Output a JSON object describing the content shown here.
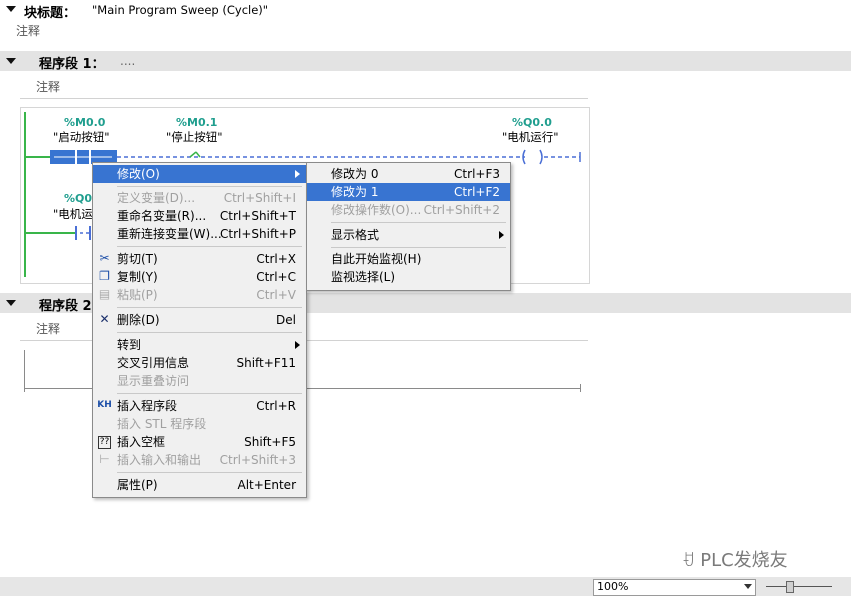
{
  "block": {
    "title_label": "块标题：",
    "title_value": "\"Main Program Sweep (Cycle)\"",
    "comment": "注释"
  },
  "network1": {
    "label": "程序段 1：",
    "title_placeholder": "....",
    "comment": "注释",
    "contact1": {
      "address": "%M0.0",
      "symbol": "\"启动按钮\""
    },
    "contact2": {
      "address": "%M0.1",
      "symbol": "\"停止按钮\""
    },
    "coil": {
      "address": "%Q0.0",
      "symbol": "\"电机运行\""
    },
    "contact3": {
      "address": "%Q0.",
      "symbol": "\"电机运"
    }
  },
  "network2": {
    "label": "程序段 2",
    "comment": "注释"
  },
  "context_menu": {
    "items": [
      {
        "label": "修改(O)",
        "shortcut": "",
        "submenu": true,
        "highlighted": true,
        "disabled": false
      },
      {
        "label": "定义变量(D)...",
        "shortcut": "Ctrl+Shift+I",
        "disabled": true
      },
      {
        "label": "重命名变量(R)...",
        "shortcut": "Ctrl+Shift+T"
      },
      {
        "label": "重新连接变量(W)...",
        "shortcut": "Ctrl+Shift+P"
      },
      {
        "label": "剪切(T)",
        "shortcut": "Ctrl+X",
        "icon": "scissors-icon"
      },
      {
        "label": "复制(Y)",
        "shortcut": "Ctrl+C",
        "icon": "copy-icon"
      },
      {
        "label": "粘贴(P)",
        "shortcut": "Ctrl+V",
        "icon": "paste-icon",
        "disabled": true
      },
      {
        "label": "删除(D)",
        "shortcut": "Del",
        "icon": "delete-icon"
      },
      {
        "label": "转到",
        "shortcut": "",
        "submenu": true
      },
      {
        "label": "交叉引用信息",
        "shortcut": "Shift+F11"
      },
      {
        "label": "显示重叠访问",
        "shortcut": "",
        "disabled": true
      },
      {
        "label": "插入程序段",
        "shortcut": "Ctrl+R",
        "icon": "insert-network-icon"
      },
      {
        "label": "插入 STL 程序段",
        "shortcut": "",
        "disabled": true
      },
      {
        "label": "插入空框",
        "shortcut": "Shift+F5",
        "icon": "empty-box-icon"
      },
      {
        "label": "插入输入和输出",
        "shortcut": "Ctrl+Shift+3",
        "icon": "insert-io-icon",
        "disabled": true
      },
      {
        "label": "属性(P)",
        "shortcut": "Alt+Enter"
      }
    ]
  },
  "submenu": {
    "items": [
      {
        "label": "修改为 0",
        "shortcut": "Ctrl+F3"
      },
      {
        "label": "修改为 1",
        "shortcut": "Ctrl+F2",
        "highlighted": true
      },
      {
        "label": "修改操作数(O)...",
        "shortcut": "Ctrl+Shift+2",
        "disabled": true
      },
      {
        "label": "显示格式",
        "shortcut": "",
        "submenu": true
      },
      {
        "label": "自此开始监视(H)",
        "shortcut": ""
      },
      {
        "label": "监视选择(L)",
        "shortcut": ""
      }
    ]
  },
  "statusbar": {
    "zoom": "100%"
  },
  "watermark": "PLC发烧友",
  "colors": {
    "accent": "#3874d1",
    "energized": "#39b54a",
    "unpowered": "#4a6fd6",
    "tag": "#1f9e8e",
    "arrow": "#e02020"
  }
}
